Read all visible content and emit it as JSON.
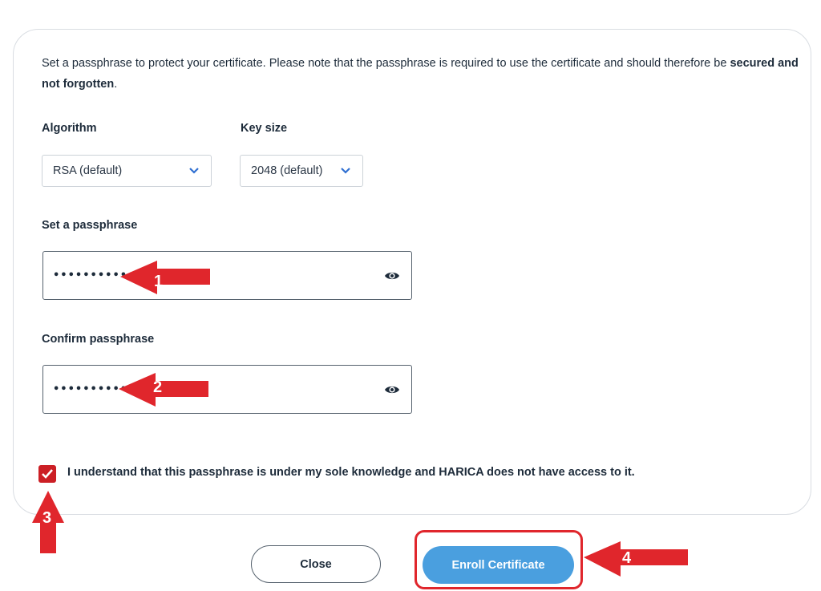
{
  "intro": {
    "text_before": "Set a passphrase to protect your certificate. Please note that the passphrase is required to use the certificate and should therefore be ",
    "text_bold": "secured and not forgotten",
    "text_after": "."
  },
  "algorithm": {
    "label": "Algorithm",
    "value": "RSA (default)"
  },
  "key_size": {
    "label": "Key size",
    "value": "2048 (default)"
  },
  "passphrase": {
    "label": "Set a passphrase",
    "masked_value": "••••••••••••"
  },
  "confirm_passphrase": {
    "label": "Confirm passphrase",
    "masked_value": "••••••••••••"
  },
  "consent": {
    "checked": true,
    "label": "I understand that this passphrase is under my sole knowledge and HARICA does not have access to it."
  },
  "buttons": {
    "close": "Close",
    "enroll": "Enroll Certificate"
  },
  "annotations": [
    "1",
    "2",
    "3",
    "4"
  ],
  "colors": {
    "accent_blue": "#4a9fdf",
    "checkbox_red": "#cc1f25",
    "annotation_red": "#e0262c",
    "chevron_blue": "#2f6fd1"
  },
  "icons": {
    "dropdown": "chevron-down-icon",
    "reveal": "eye-icon",
    "check": "checkmark-icon",
    "annotation": "arrow-icon"
  }
}
